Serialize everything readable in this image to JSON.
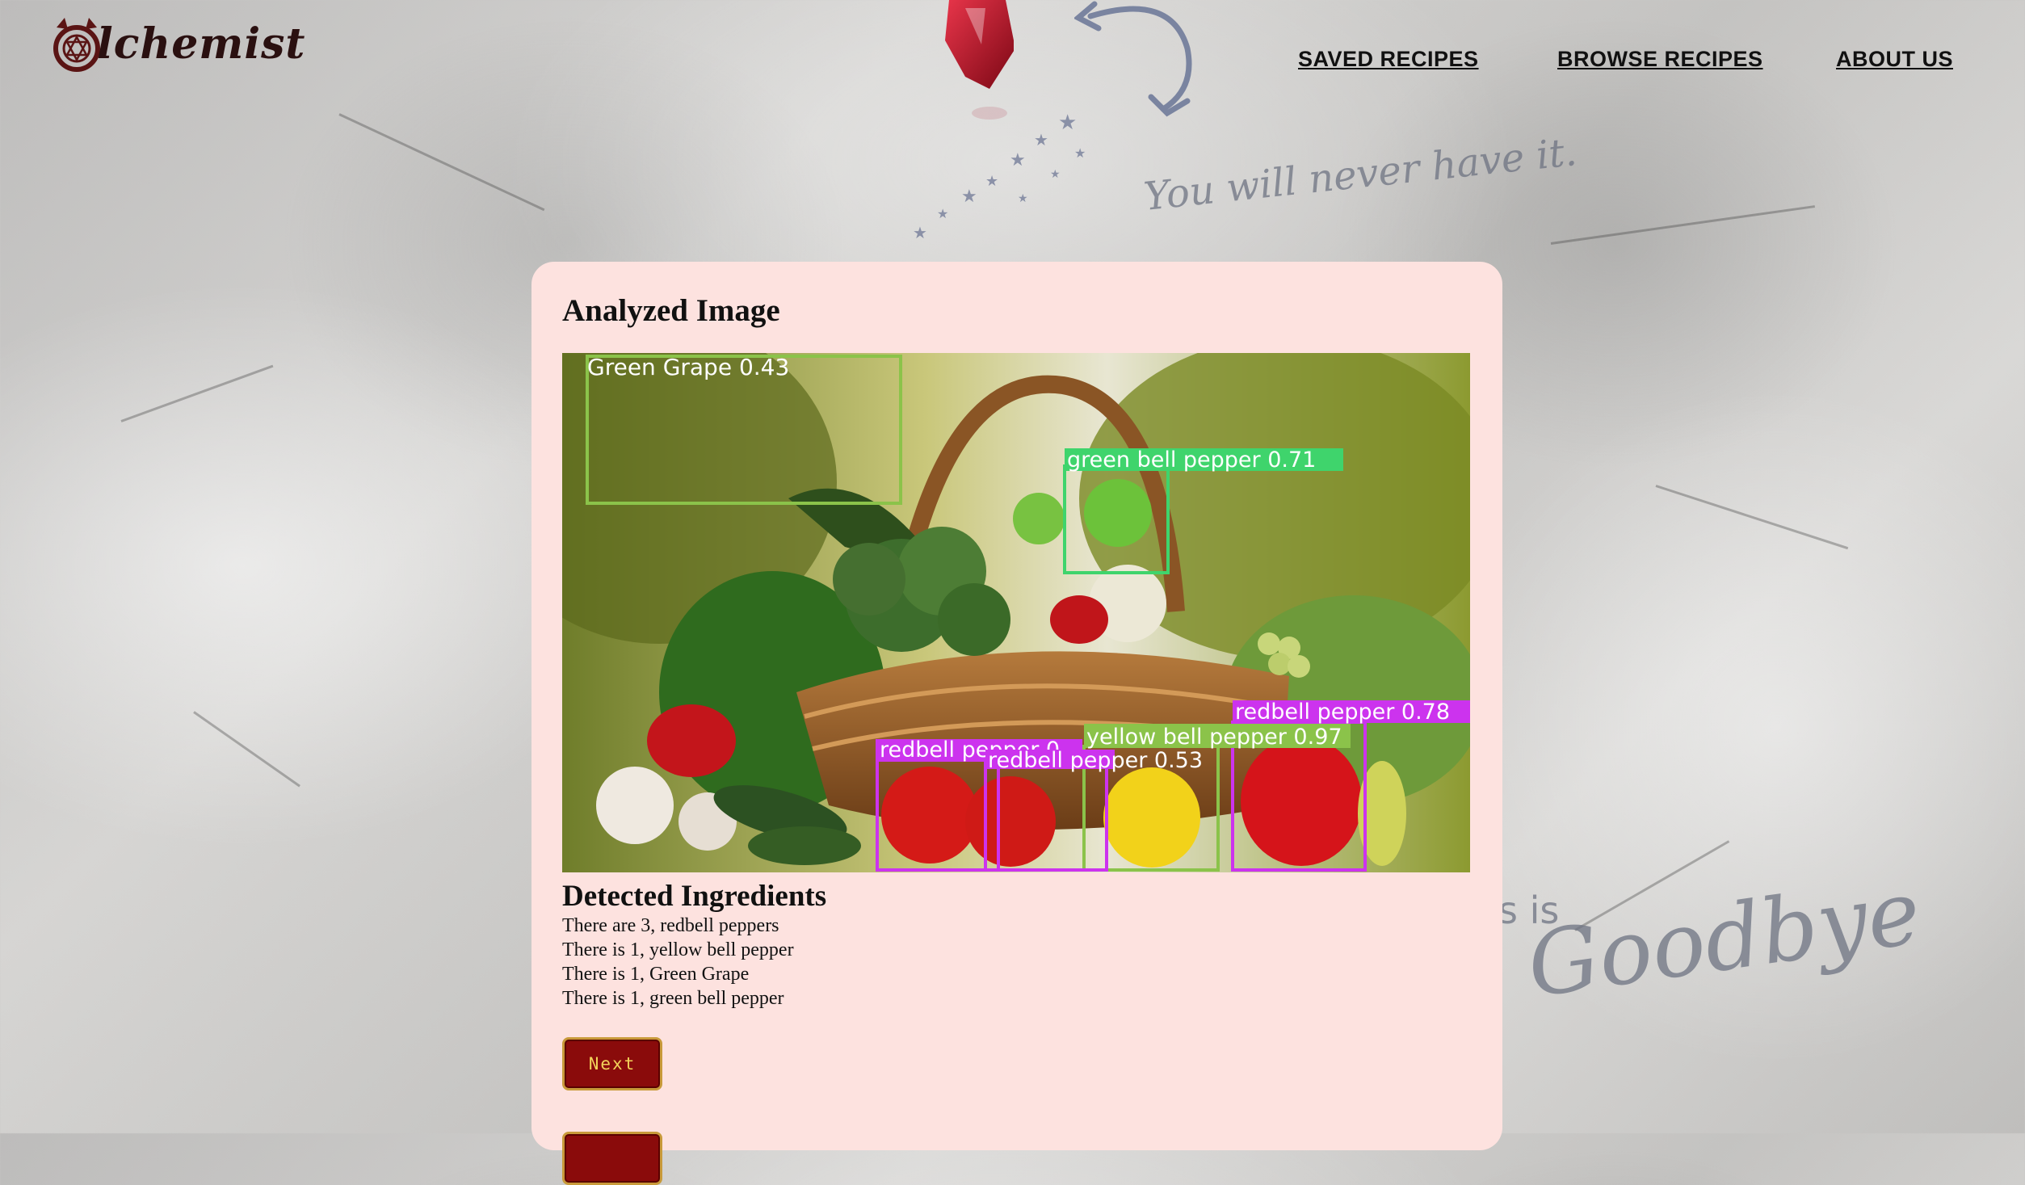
{
  "header": {
    "logo_text": "lchemist",
    "logo_icon": "alchemy-seal-icon",
    "nav": [
      "SAVED RECIPES",
      "BROWSE RECIPES",
      "ABOUT US"
    ]
  },
  "background": {
    "tagline": "You will never have it.",
    "goodbye_prefix": "s is",
    "goodbye_script": "Goodbye"
  },
  "card": {
    "title": "Analyzed Image",
    "detections": [
      {
        "label": "Green Grape 0.43",
        "color": "#8bc34a"
      },
      {
        "label": "green bell pepper 0.71",
        "color": "#3fd46c"
      },
      {
        "label": "redbell pepper 0.78",
        "color": "#cc33ee"
      },
      {
        "label": "yellow bell pepper 0.97",
        "color": "#8bc34a"
      },
      {
        "label": "redbell pepper 0.",
        "color": "#cc33ee"
      },
      {
        "label": "redbell pepper 0.53",
        "color": "#cc33ee"
      }
    ],
    "detected_title": "Detected Ingredients",
    "ingredients": [
      "There are 3, redbell peppers",
      "There is 1, yellow bell pepper",
      "There is 1, Green Grape",
      "There is 1, green bell pepper"
    ],
    "next_label": "Next"
  }
}
